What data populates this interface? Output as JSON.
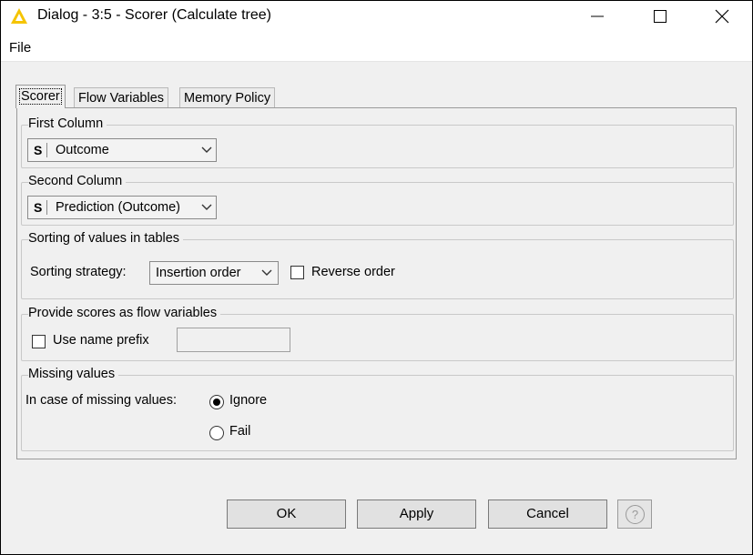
{
  "window": {
    "title": "Dialog - 3:5 - Scorer (Calculate tree)",
    "icon": "knime-triangle-icon",
    "accent_color": "#f5c400"
  },
  "menu": {
    "file": "File"
  },
  "tabs": [
    {
      "label": "Scorer",
      "active": true
    },
    {
      "label": "Flow Variables",
      "active": false
    },
    {
      "label": "Memory Policy",
      "active": false
    }
  ],
  "first_column": {
    "title": "First Column",
    "type_badge": "S",
    "value": "Outcome"
  },
  "second_column": {
    "title": "Second Column",
    "type_badge": "S",
    "value": "Prediction (Outcome)"
  },
  "sorting": {
    "title": "Sorting of values in tables",
    "strategy_label": "Sorting strategy:",
    "strategy_value": "Insertion order",
    "reverse_label": "Reverse order",
    "reverse_checked": false
  },
  "flow_vars": {
    "title": "Provide scores as flow variables",
    "prefix_label": "Use name prefix",
    "prefix_checked": false,
    "prefix_value": ""
  },
  "missing": {
    "title": "Missing values",
    "case_label": "In case of missing values:",
    "options": [
      {
        "label": "Ignore",
        "selected": true
      },
      {
        "label": "Fail",
        "selected": false
      }
    ]
  },
  "buttons": {
    "ok": "OK",
    "apply": "Apply",
    "cancel": "Cancel",
    "help": "?"
  }
}
